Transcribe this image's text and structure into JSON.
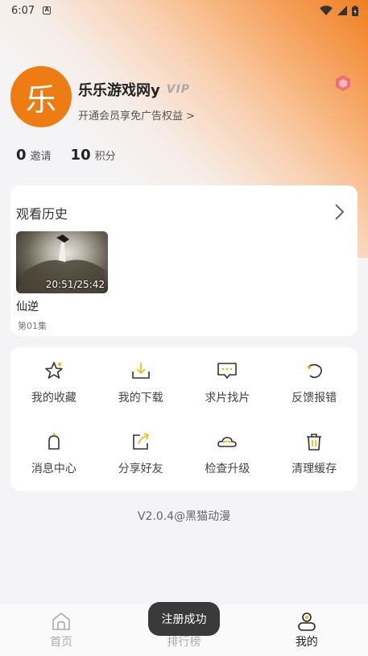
{
  "status_bar": {
    "time": "6:07",
    "app_icon_letter": "A"
  },
  "profile": {
    "avatar_char": "乐",
    "username": "乐乐游戏网y",
    "vip_badge": "VIP",
    "vip_subtitle": "开通会员享免广告权益 >",
    "accent_color": "#ed7d13"
  },
  "stats": [
    {
      "value": "0",
      "label": "邀请"
    },
    {
      "value": "10",
      "label": "积分"
    }
  ],
  "history": {
    "title": "观看历史",
    "items": [
      {
        "time": "20:51/25:42",
        "name": "仙逆",
        "episode": "第01集"
      }
    ]
  },
  "menu": [
    {
      "label": "我的收藏",
      "icon": "star-icon"
    },
    {
      "label": "我的下载",
      "icon": "download-icon"
    },
    {
      "label": "求片找片",
      "icon": "message-icon"
    },
    {
      "label": "反馈报错",
      "icon": "feedback-icon"
    },
    {
      "label": "消息中心",
      "icon": "bell-icon"
    },
    {
      "label": "分享好友",
      "icon": "share-icon"
    },
    {
      "label": "检查升级",
      "icon": "cloud-icon"
    },
    {
      "label": "清理缓存",
      "icon": "trash-icon"
    }
  ],
  "version": "V2.0.4@黑猫动漫",
  "nav": [
    {
      "label": "首页",
      "icon": "home-icon"
    },
    {
      "label": "排行榜",
      "icon": "ranking-icon"
    },
    {
      "label": "我的",
      "icon": "user-icon"
    }
  ],
  "toast": "注册成功"
}
